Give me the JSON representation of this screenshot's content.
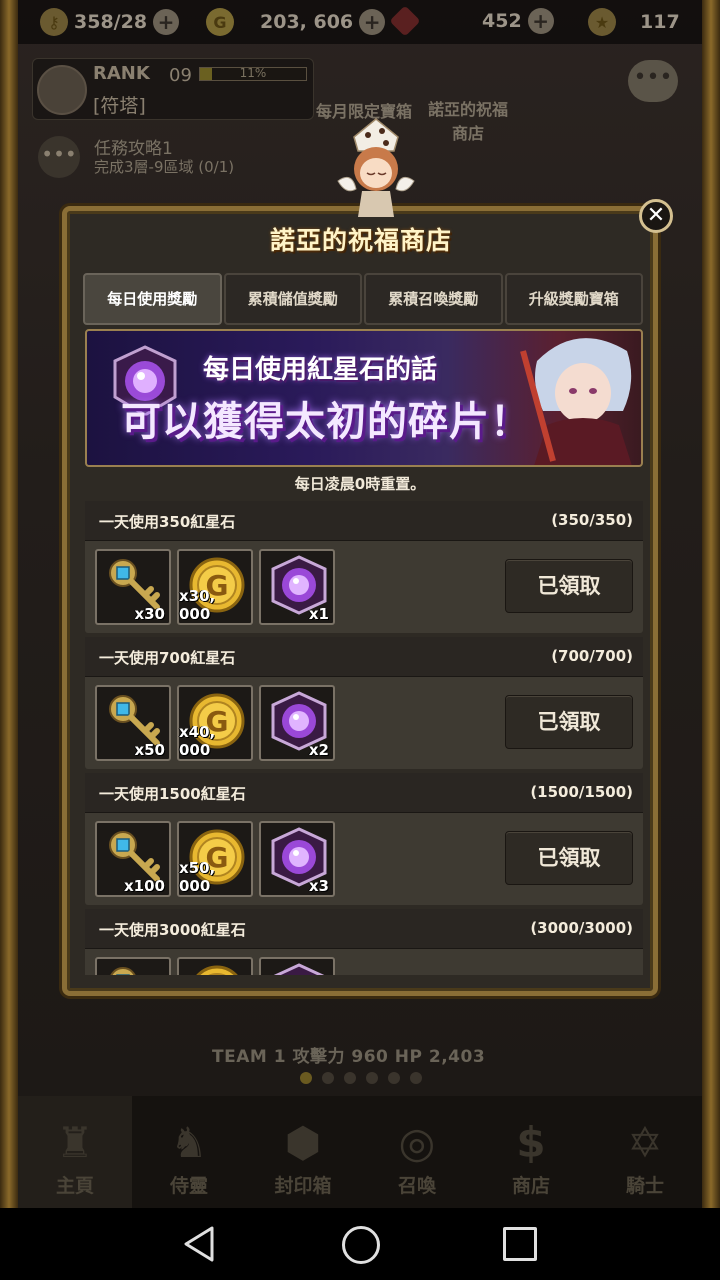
{
  "top_bar": {
    "keys": "358/28",
    "gold": "203, 606",
    "gems": "452",
    "stamina": "117"
  },
  "rank": {
    "label": "RANK",
    "level": "09",
    "progress_text": "11%",
    "progress_fraction": 0.11,
    "subtitle": "[符塔]"
  },
  "quest": {
    "title": "任務攻略1",
    "desc": "完成3層-9區域 (0/1)"
  },
  "shortcuts": {
    "monthly": "每月限定寶箱",
    "noa_shop": "諾亞的祝福商店"
  },
  "team_info": "TEAM 1  攻擊力  960  HP  2,403",
  "bottom_nav": [
    {
      "label": "主頁",
      "icon": "castle-icon"
    },
    {
      "label": "侍靈",
      "icon": "spirits-icon"
    },
    {
      "label": "封印箱",
      "icon": "seal-box-icon"
    },
    {
      "label": "召喚",
      "icon": "summon-icon"
    },
    {
      "label": "商店",
      "icon": "shop-icon"
    },
    {
      "label": "騎士",
      "icon": "knight-icon"
    }
  ],
  "modal": {
    "title": "諾亞的祝福商店",
    "close_icon": "close-icon",
    "tabs": [
      "每日使用獎勵",
      "累積儲值獎勵",
      "累積召喚獎勵",
      "升級獎勵寶箱"
    ],
    "active_tab": 0,
    "banner": {
      "line1": "每日使用紅星石的話",
      "line2": "可以獲得太初的碎片！"
    },
    "reset_note": "每日凌晨0時重置。",
    "rewards": [
      {
        "condition": "一天使用350紅星石",
        "progress": "(350/350)",
        "items": [
          {
            "icon": "key-icon",
            "qty": "x30"
          },
          {
            "icon": "gold-coin-icon",
            "qty": "x30, 000"
          },
          {
            "icon": "purple-crystal-icon",
            "qty": "x1"
          }
        ],
        "button": "已領取"
      },
      {
        "condition": "一天使用700紅星石",
        "progress": "(700/700)",
        "items": [
          {
            "icon": "key-icon",
            "qty": "x50"
          },
          {
            "icon": "gold-coin-icon",
            "qty": "x40, 000"
          },
          {
            "icon": "purple-crystal-icon",
            "qty": "x2"
          }
        ],
        "button": "已領取"
      },
      {
        "condition": "一天使用1500紅星石",
        "progress": "(1500/1500)",
        "items": [
          {
            "icon": "key-icon",
            "qty": "x100"
          },
          {
            "icon": "gold-coin-icon",
            "qty": "x50, 000"
          },
          {
            "icon": "purple-crystal-icon",
            "qty": "x3"
          }
        ],
        "button": "已領取"
      },
      {
        "condition": "一天使用3000紅星石",
        "progress": "(3000/3000)",
        "items": [
          {
            "icon": "key-icon",
            "qty": ""
          },
          {
            "icon": "gold-coin-icon",
            "qty": ""
          },
          {
            "icon": "purple-crystal-icon",
            "qty": ""
          }
        ],
        "button": ""
      }
    ]
  },
  "colors": {
    "modal_border": "#8a6e36",
    "title_text": "#fff4c8",
    "gold": "#d4a820",
    "crystal": "#b060e0"
  }
}
